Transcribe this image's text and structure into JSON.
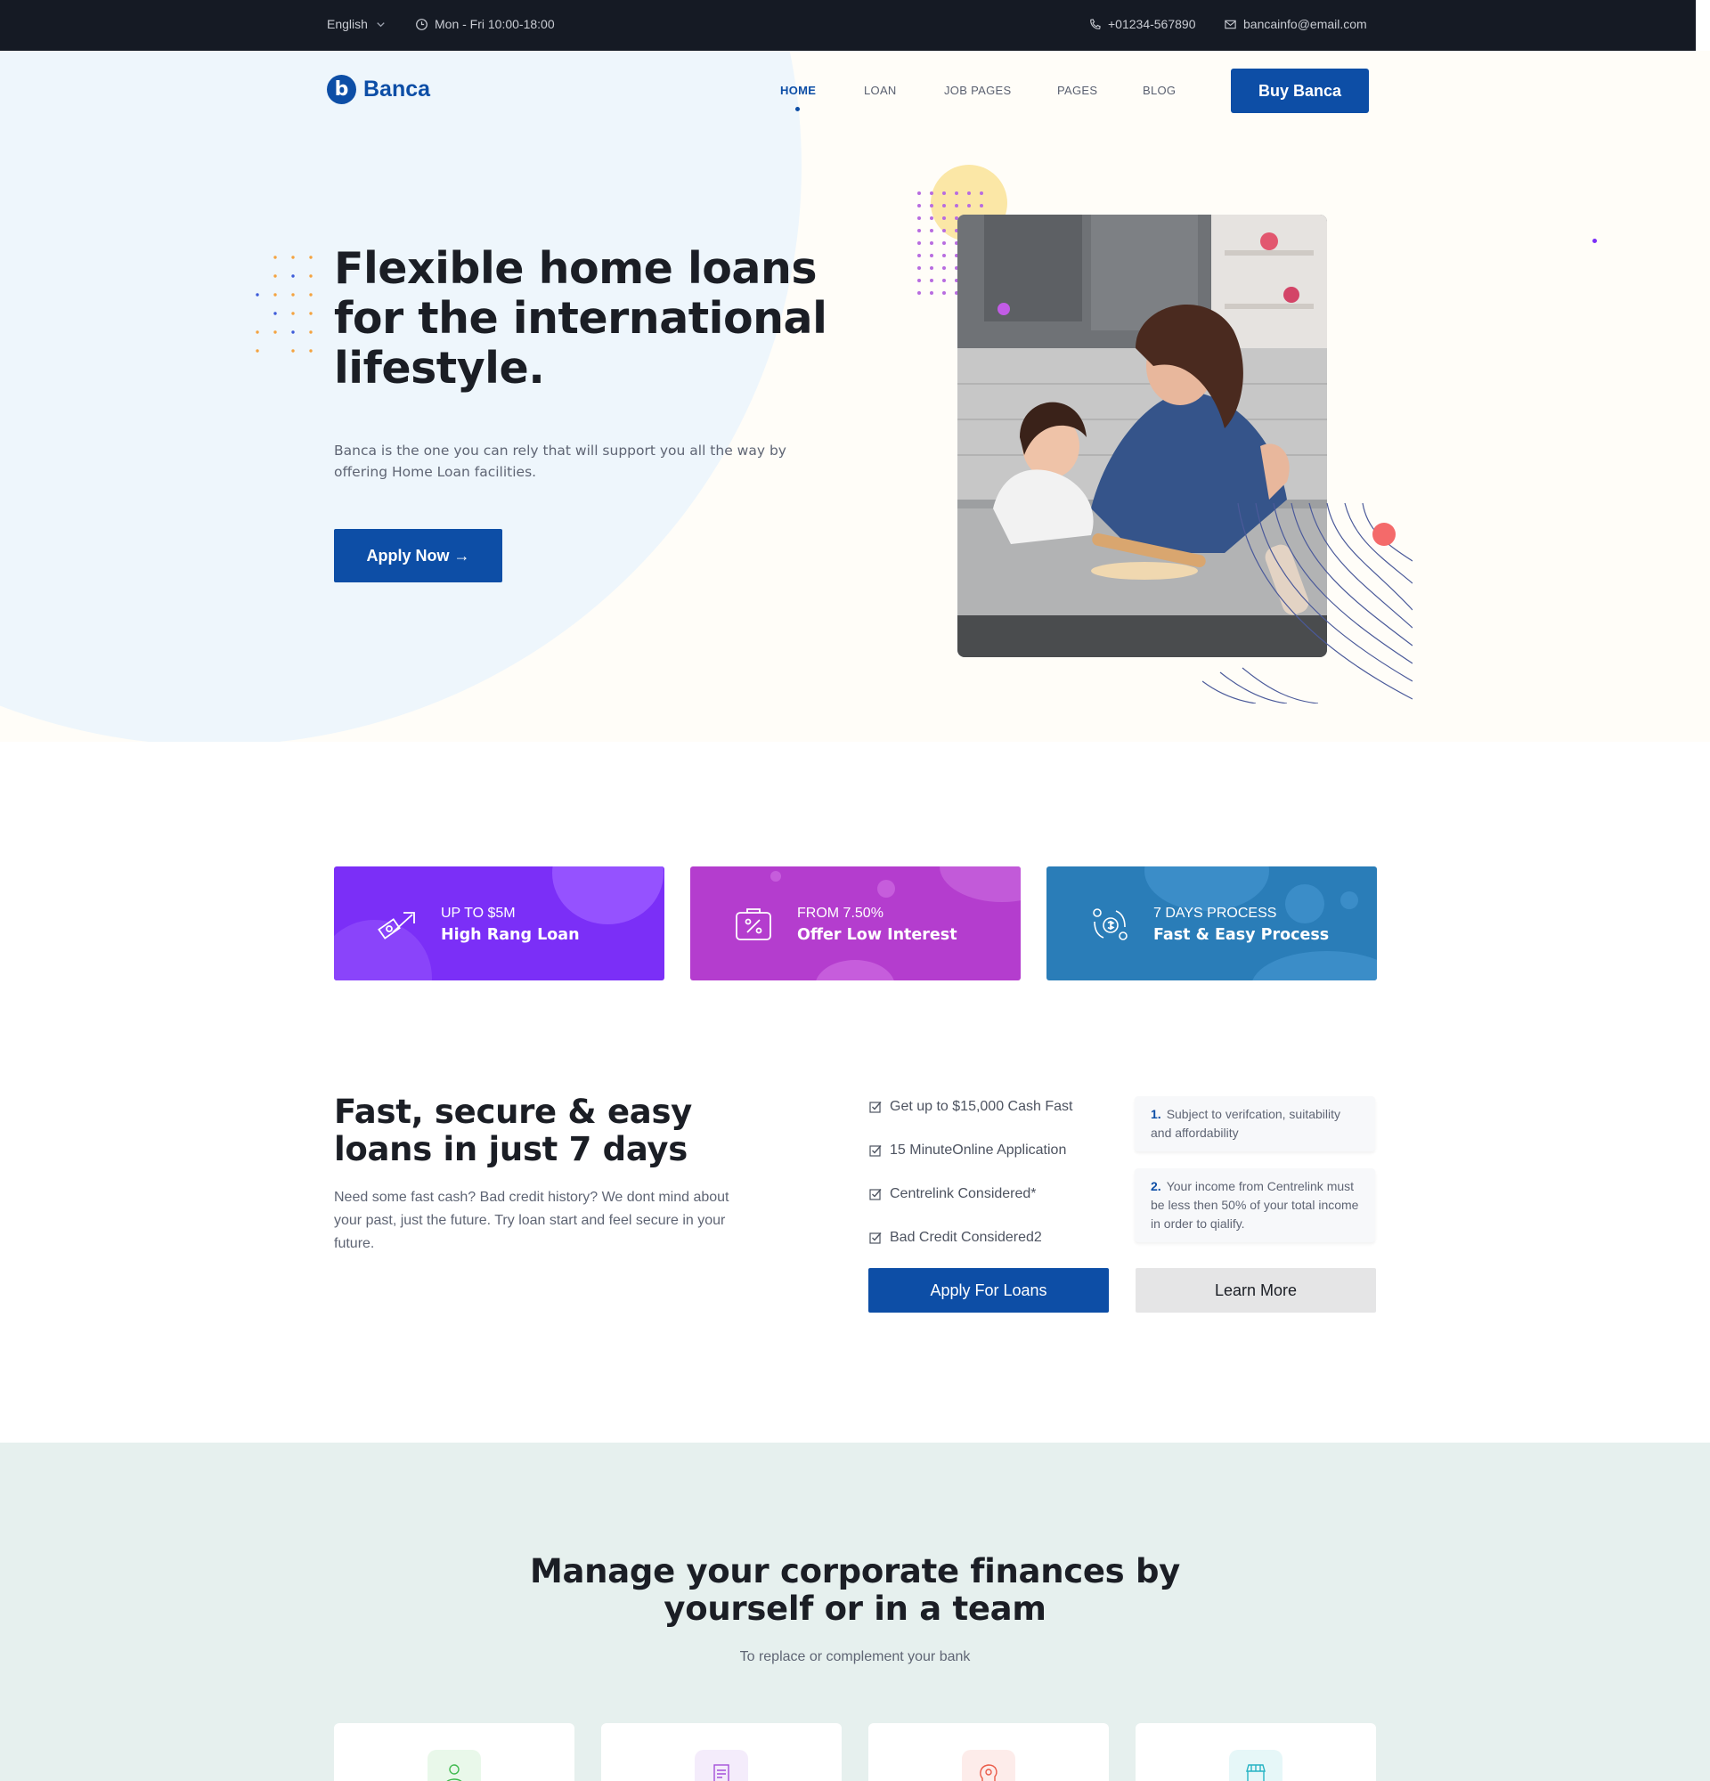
{
  "topbar": {
    "language": "English",
    "hours": "Mon - Fri 10:00-18:00",
    "phone": "+01234-567890",
    "email": "bancainfo@email.com"
  },
  "brand": {
    "name": "Banca",
    "mark": "b",
    "color": "#0d4ea6"
  },
  "nav": {
    "items": [
      "HOME",
      "LOAN",
      "JOB PAGES",
      "PAGES",
      "BLOG"
    ],
    "active": "HOME",
    "cta": "Buy Banca"
  },
  "hero": {
    "title": "Flexible home loans for the international lifestyle.",
    "text": "Banca is the one you can rely that will support you all the way by offering Home Loan facilities.",
    "button": "Apply Now →",
    "image_icon": "mother-daughter-baking-photo"
  },
  "features": [
    {
      "small": "UP TO $5M",
      "big": "High Rang Loan",
      "icon": "money-growth-icon",
      "color": "#7b2ff7"
    },
    {
      "small": "FROM 7.50%",
      "big": "Offer Low Interest",
      "icon": "percent-tag-icon",
      "color": "#b43dce"
    },
    {
      "small": "7 DAYS PROCESS",
      "big": "Fast & Easy Process",
      "icon": "gear-dollar-icon",
      "color": "#2a7db8"
    }
  ],
  "fast": {
    "title": "Fast, secure & easy loans in just 7 days",
    "text": "Need some fast cash? Bad credit history? We dont mind about your past, just the future. Try loan start and feel secure in your future.",
    "checks": [
      "Get up to $15,000 Cash Fast",
      "15 MinuteOnline Application",
      "Centrelink Considered*",
      "Bad Credit Considered2"
    ],
    "notes": [
      {
        "num": "1.",
        "text": "Subject to verifcation, suitability and affordability"
      },
      {
        "num": "2.",
        "text": "Your income from Centrelink must be less then 50% of your total income in order to qialify."
      }
    ],
    "apply_button": "Apply For Loans",
    "learn_button": "Learn More"
  },
  "manage": {
    "title": "Manage your corporate finances by yourself or in a team",
    "subtitle": "To replace or complement your bank",
    "cards": [
      {
        "icon": "user-person-icon",
        "bg": "#e9f8ea",
        "color": "#3fb94d"
      },
      {
        "icon": "receipt-icon",
        "bg": "#f4ecfb",
        "color": "#a44fd9"
      },
      {
        "icon": "lightbulb-head-icon",
        "bg": "#fdecea",
        "color": "#ea5a48"
      },
      {
        "icon": "storefront-icon",
        "bg": "#e6f7f8",
        "color": "#27b4c4"
      }
    ]
  }
}
